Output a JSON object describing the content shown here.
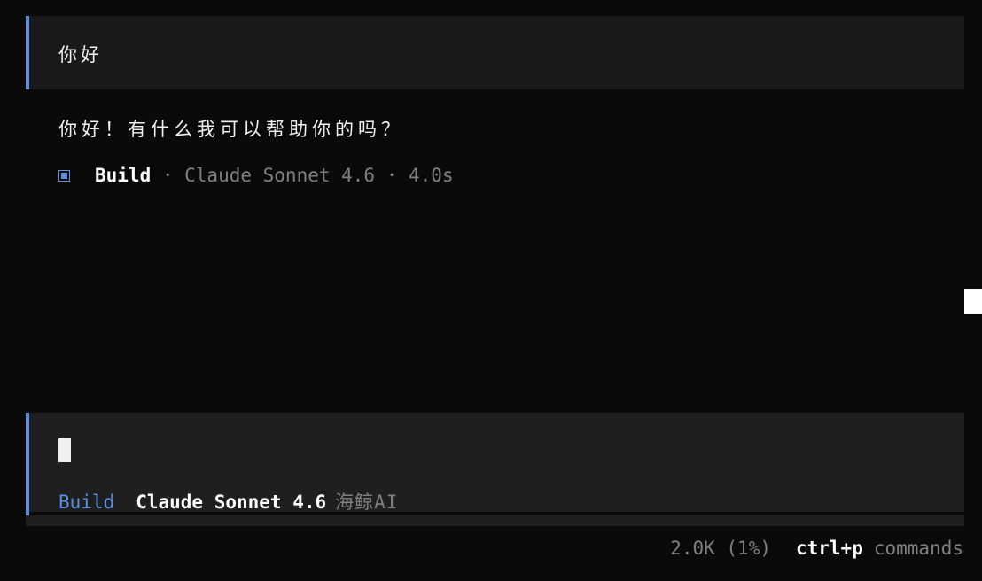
{
  "conversation": {
    "user_message": "你好",
    "assistant_message": "你好！有什么我可以帮助你的吗？",
    "meta": {
      "agent": "Build",
      "details": " · Claude Sonnet 4.6 · 4.0s"
    }
  },
  "input": {
    "value": "",
    "agent_mode": "Build",
    "model": "Claude Sonnet 4.6",
    "provider": "海鲸AI"
  },
  "footer": {
    "tokens": "2.0K (1%)",
    "shortcut_key": "ctrl+p",
    "shortcut_label": "commands"
  },
  "colors": {
    "accent": "#5b8fe0",
    "background": "#0a0a0a",
    "panel": "#1f1f1f",
    "muted": "#808080"
  }
}
